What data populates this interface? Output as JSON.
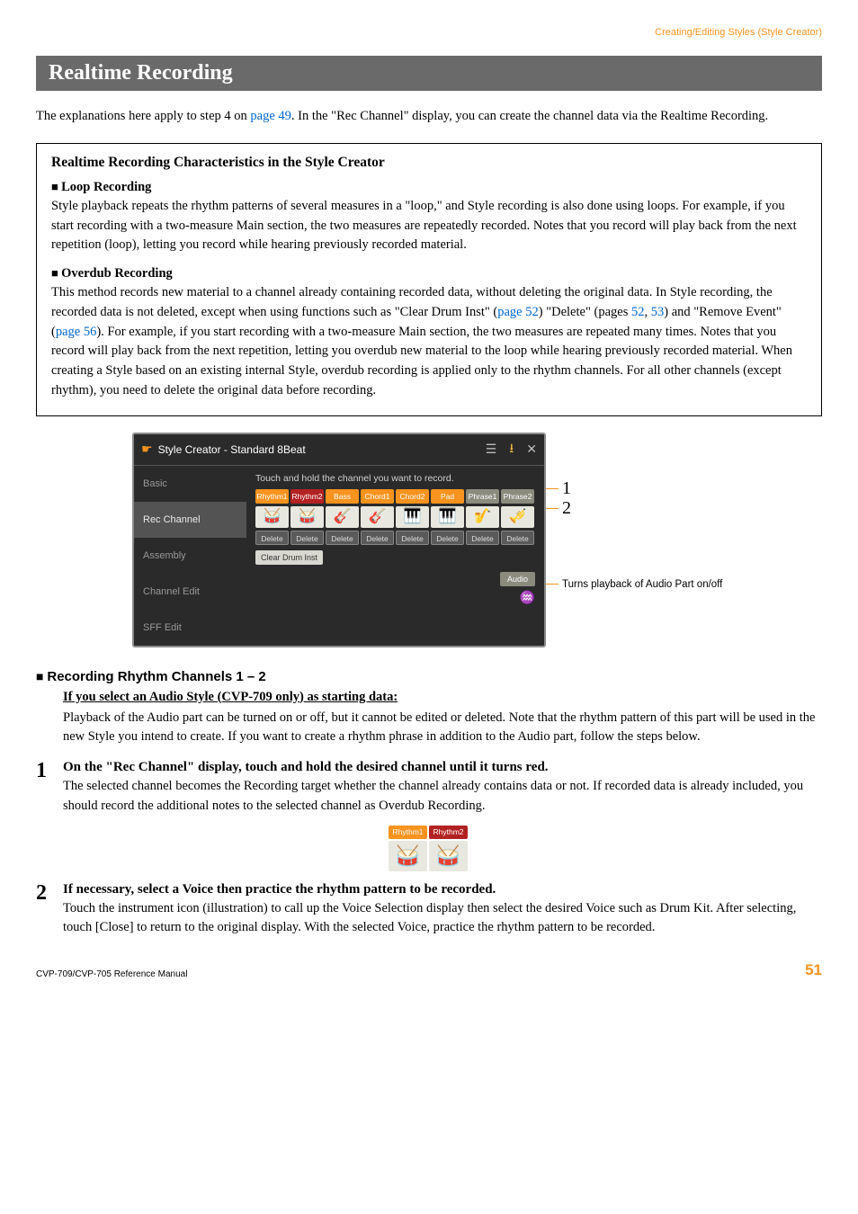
{
  "breadcrumb": "Creating/Editing Styles (Style Creator)",
  "title": "Realtime Recording",
  "intro_a": "The explanations here apply to step 4 on ",
  "intro_link1": "page 49",
  "intro_b": ". In the \"Rec Channel\" display, you can create the channel data via the Realtime Recording.",
  "box": {
    "title": "Realtime Recording Characteristics in the Style Creator",
    "loop_head": "Loop Recording",
    "loop_text": "Style playback repeats the rhythm patterns of several measures in a \"loop,\" and Style recording is also done using loops. For example, if you start recording with a two-measure Main section, the two measures are repeatedly recorded. Notes that you record will play back from the next repetition (loop), letting you record while hearing previously recorded material.",
    "overdub_head": "Overdub Recording",
    "overdub_a": "This method records new material to a channel already containing recorded data, without deleting the original data. In Style recording, the recorded data is not deleted, except when using functions such as \"Clear Drum Inst\" (",
    "overdub_link1": "page 52",
    "overdub_b": ") \"Delete\" (pages ",
    "overdub_link2": "52",
    "overdub_c": ", ",
    "overdub_link3": "53",
    "overdub_d": ") and \"Remove Event\" (",
    "overdub_link4": "page 56",
    "overdub_e": "). For example, if you start recording with a two-measure Main section, the two measures are repeated many times. Notes that you record will play back from the next repetition, letting you overdub new material to the loop while hearing previously recorded material. When creating a Style based on an existing internal Style, overdub recording is applied only to the rhythm channels. For all other channels (except rhythm), you need to delete the original data before recording."
  },
  "screenshot": {
    "window_title": "Style Creator - Standard 8Beat",
    "sidebar": [
      "Basic",
      "Rec Channel",
      "Assembly",
      "Channel Edit",
      "SFF Edit"
    ],
    "instruction": "Touch and hold the channel you want to record.",
    "channels": [
      "Rhythm1",
      "Rhythm2",
      "Bass",
      "Chord1",
      "Chord2",
      "Pad",
      "Phrase1",
      "Phrase2"
    ],
    "delete_label": "Delete",
    "clear_label": "Clear Drum Inst",
    "audio_label": "Audio",
    "annot1": "1",
    "annot2": "2",
    "annot3": "Turns playback of Audio Part on/off"
  },
  "section_head": "Recording Rhythm Channels 1 – 2",
  "sub1_title": "If you select an Audio Style (CVP-709 only) as starting data:",
  "sub1_text": "Playback of the Audio part can be turned on or off, but it cannot be edited or deleted. Note that the rhythm pattern of this part will be used in the new Style you intend to create. If you want to create a rhythm phrase in addition to the Audio part, follow the steps below.",
  "step1_num": "1",
  "step1_title": "On the \"Rec Channel\" display, touch and hold the desired channel until it turns red.",
  "step1_text": "The selected channel becomes the Recording target whether the channel already contains data or not. If recorded data is already included, you should record the additional notes to the selected channel as Overdub Recording.",
  "mini": {
    "c1": "Rhythm1",
    "c2": "Rhythm2"
  },
  "step2_num": "2",
  "step2_title": "If necessary, select a Voice then practice the rhythm pattern to be recorded.",
  "step2_text": "Touch the instrument icon (illustration) to call up the Voice Selection display then select the desired Voice such as Drum Kit. After selecting, touch [Close] to return to the original display. With the selected Voice, practice the rhythm pattern to be recorded.",
  "footer_left": "CVP-709/CVP-705 Reference Manual",
  "footer_right": "51"
}
